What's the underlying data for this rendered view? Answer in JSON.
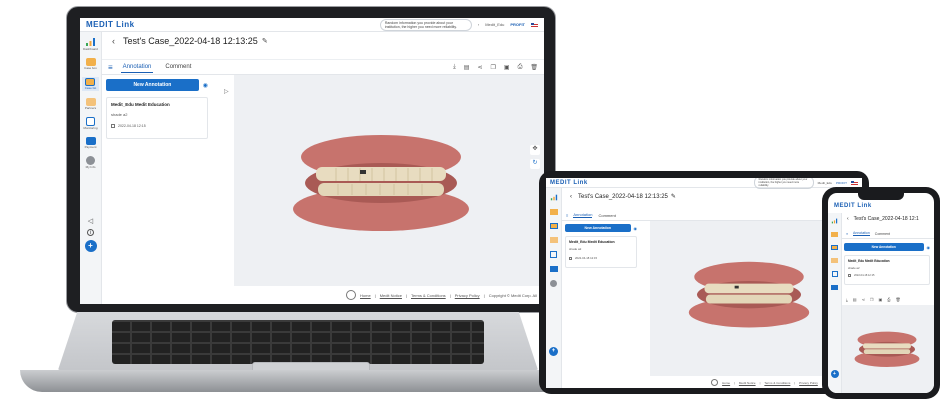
{
  "app": {
    "logo": "MEDIT Link",
    "notice": "Random information you provide about your institution, the higher you need more reliability.",
    "user": "Medit_Edu",
    "user_tag": "PROFIT"
  },
  "sidebar": {
    "items": [
      {
        "label": "Dashboard",
        "icon": "dashboard-icon"
      },
      {
        "label": "Case box",
        "icon": "case-box-icon"
      },
      {
        "label": "Case list",
        "icon": "case-list-icon"
      },
      {
        "label": "Partners",
        "icon": "partners-icon"
      },
      {
        "label": "Monitoring",
        "icon": "monitoring-icon"
      },
      {
        "label": "Payment",
        "icon": "payment-icon"
      },
      {
        "label": "My Info",
        "icon": "my-info-icon"
      }
    ]
  },
  "case": {
    "title": "Test's Case_2022-04-18 12:13:25"
  },
  "tabs": {
    "annotation": "Annotation",
    "comment": "Comment"
  },
  "annotation": {
    "new_button": "New Annotation",
    "card_title": "Medit_Edu Medit Education",
    "card_shade": "shade a2",
    "card_date": "2022-04-18 12:15"
  },
  "footer": {
    "home": "Home",
    "notice": "Medit Notice",
    "terms": "Terms & Conditions",
    "privacy": "Privacy Policy",
    "copyright": "Copyright © Medit Corp. All"
  },
  "tablet_footer": {
    "home": "Home",
    "notice": "Medit Notice",
    "terms": "Terms & Conditions",
    "privacy": "Privacy Policy",
    "copyright": "Copyright © Medit Corp"
  },
  "phone": {
    "logo": "MEDIT Link",
    "title": "Test's Case_2022-04-18 12:1"
  },
  "colors": {
    "accent": "#1a6fc8",
    "gum": "#c7736d",
    "teeth": "#e8dcc0"
  }
}
